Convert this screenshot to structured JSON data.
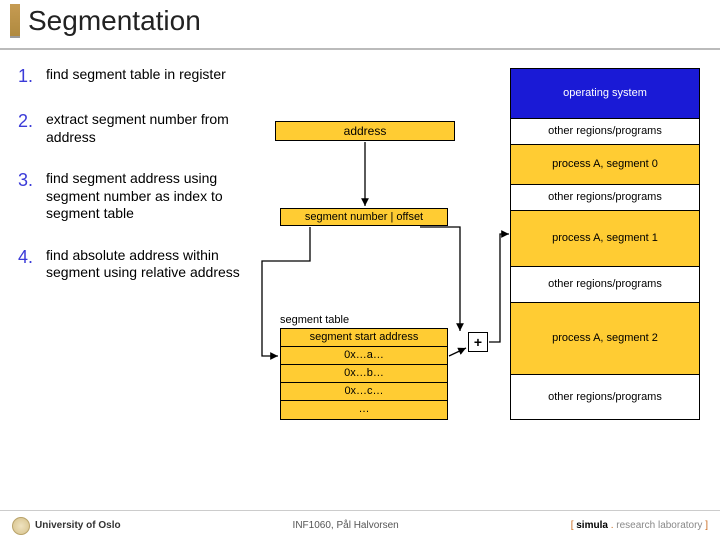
{
  "title": "Segmentation",
  "steps": [
    {
      "num": "1.",
      "text": "find segment table in register"
    },
    {
      "num": "2.",
      "text": "extract segment number from address"
    },
    {
      "num": "3.",
      "text": "find segment address using segment number as index to segment table"
    },
    {
      "num": "4.",
      "text": "find absolute address within segment using relative address"
    }
  ],
  "diagram": {
    "address_label": "address",
    "segoff": {
      "left": "segment number",
      "sep": "|",
      "right": "offset"
    },
    "seg_table_label": "segment table",
    "seg_table_header": "segment start address",
    "seg_table_rows": [
      "0x…a…",
      "0x…b…",
      "0x…c…",
      "…"
    ],
    "plus": "+"
  },
  "memory": {
    "os": "operating system",
    "other": "other regions/programs",
    "procA0": "process A, segment 0",
    "procA1": "process A, segment 1",
    "procA2": "process A, segment 2"
  },
  "footer": {
    "left": "University of Oslo",
    "center": "INF1060,   Pål Halvorsen",
    "right_open": "[ ",
    "right_simula": "simula",
    "right_dot": " . ",
    "right_lab": "research laboratory",
    "right_close": " ]"
  }
}
